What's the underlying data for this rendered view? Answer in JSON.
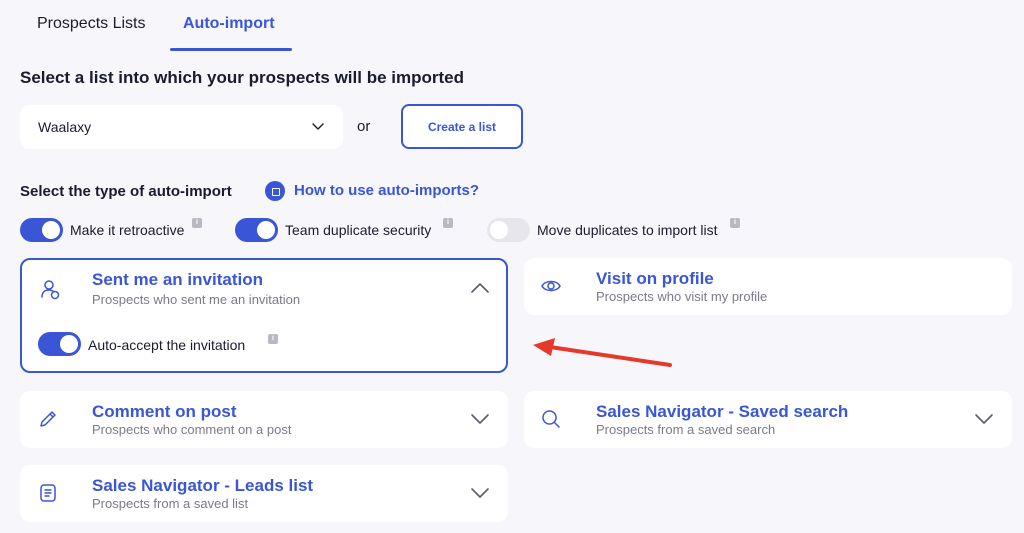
{
  "tabs": [
    {
      "label": "Prospects Lists",
      "active": false
    },
    {
      "label": "Auto-import",
      "active": true
    }
  ],
  "heading_select_list": "Select a list into which your prospects will be imported",
  "list_select": {
    "value": "Waalaxy"
  },
  "or_text": "or",
  "create_list_label": "Create a list",
  "heading_type": "Select the type of auto-import",
  "help_link": "How to use auto-imports?",
  "options": [
    {
      "label": "Make it retroactive",
      "enabled": true
    },
    {
      "label": "Team duplicate security",
      "enabled": true
    },
    {
      "label": "Move duplicates to import list",
      "enabled": false
    }
  ],
  "info_glyph": "i",
  "cards": {
    "invitation": {
      "title": "Sent me an invitation",
      "subtitle": "Prospects who sent me an invitation",
      "icon": "person-icon",
      "expanded": true,
      "auto_accept_label": "Auto-accept the invitation",
      "auto_accept_enabled": true
    },
    "visit": {
      "title": "Visit on profile",
      "subtitle": "Prospects who visit my profile",
      "icon": "eye-icon"
    },
    "comment": {
      "title": "Comment on post",
      "subtitle": "Prospects who comment on a post",
      "icon": "pencil-icon"
    },
    "saved_search": {
      "title": "Sales Navigator - Saved search",
      "subtitle": "Prospects from a saved search",
      "icon": "search-icon"
    },
    "leads_list": {
      "title": "Sales Navigator - Leads list",
      "subtitle": "Prospects from a saved list",
      "icon": "document-icon"
    }
  },
  "colors": {
    "accent": "#3a55d6",
    "background": "#f6f6fb",
    "arrow": "#e5392b"
  }
}
